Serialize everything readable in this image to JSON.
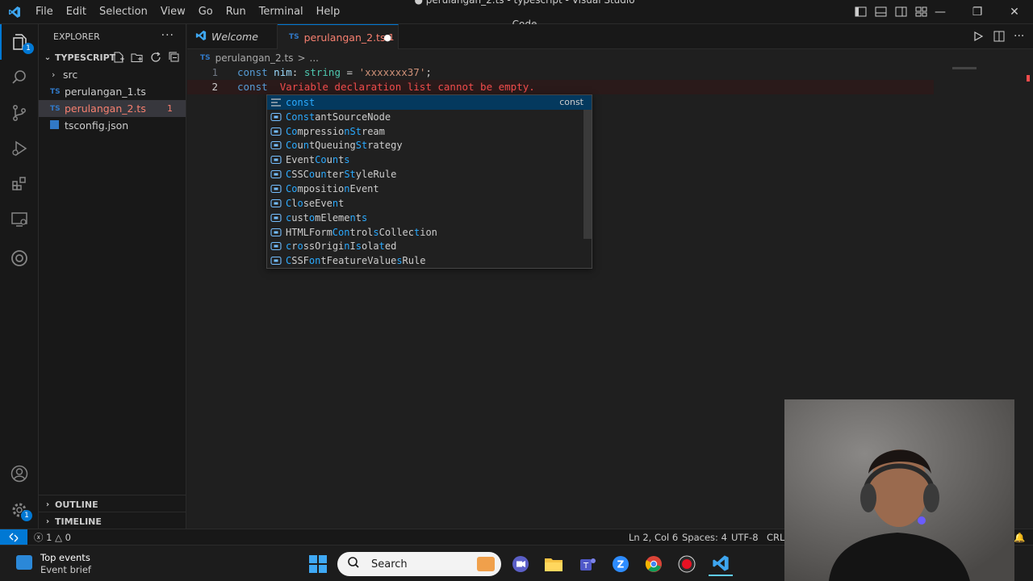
{
  "titlebar": {
    "menu": [
      "File",
      "Edit",
      "Selection",
      "View",
      "Go",
      "Run",
      "Terminal",
      "Help"
    ],
    "window_title": "● perulangan_2.ts - typescript - Visual Studio Code"
  },
  "activity": {
    "explorer_badge": "1",
    "settings_badge": "1"
  },
  "sidebar": {
    "header": "EXPLORER",
    "more": "···",
    "workspace": "TYPESCRIPT",
    "items": [
      {
        "label": "src",
        "type": "folder"
      },
      {
        "label": "perulangan_1.ts",
        "type": "ts"
      },
      {
        "label": "perulangan_2.ts",
        "type": "ts",
        "problems": "1"
      },
      {
        "label": "tsconfig.json",
        "type": "json"
      }
    ],
    "ts_badge": "TS",
    "outline": "OUTLINE",
    "timeline": "TIMELINE"
  },
  "tabs": [
    {
      "label": "Welcome"
    },
    {
      "label": "perulangan_2.ts",
      "problems": "1",
      "modified": "●"
    }
  ],
  "breadcrumb": {
    "file": "perulangan_2.ts",
    "sep": ">",
    "rest": "..."
  },
  "editor": {
    "lines": [
      {
        "num": "1"
      },
      {
        "num": "2",
        "error": "Variable declaration list cannot be empty."
      }
    ],
    "line1_kw": "const",
    "line1_var": "nim",
    "line1_colon": ":",
    "line1_type": "string",
    "line1_eq": "=",
    "line1_str": "'xxxxxxx37'",
    "line1_semi": ";",
    "line2_kw": "const"
  },
  "suggest": {
    "items": [
      {
        "label": "const",
        "detail": "const",
        "kind": "keyword"
      },
      {
        "label": "ConstantSourceNode",
        "kind": "variable"
      },
      {
        "label": "CompressionStream",
        "kind": "variable"
      },
      {
        "label": "CountQueuingStrategy",
        "kind": "variable"
      },
      {
        "label": "EventCounts",
        "kind": "variable"
      },
      {
        "label": "CSSCounterStyleRule",
        "kind": "variable"
      },
      {
        "label": "CompositionEvent",
        "kind": "variable"
      },
      {
        "label": "CloseEvent",
        "kind": "variable"
      },
      {
        "label": "customElements",
        "kind": "variable"
      },
      {
        "label": "HTMLFormControlsCollection",
        "kind": "variable"
      },
      {
        "label": "crossOriginIsolated",
        "kind": "variable"
      },
      {
        "label": "CSSFontFeatureValuesRule",
        "kind": "variable"
      }
    ]
  },
  "statusbar": {
    "errors": "1",
    "warnings": "0",
    "position": "Ln 2, Col 6",
    "spaces": "Spaces: 4",
    "encoding": "UTF-8",
    "eol": "CRLF"
  },
  "taskbar": {
    "weather_title": "Top events",
    "weather_sub": "Event brief",
    "search_placeholder": "Search"
  },
  "colors": {
    "accent": "#0078d4",
    "error": "#f14c4c"
  }
}
